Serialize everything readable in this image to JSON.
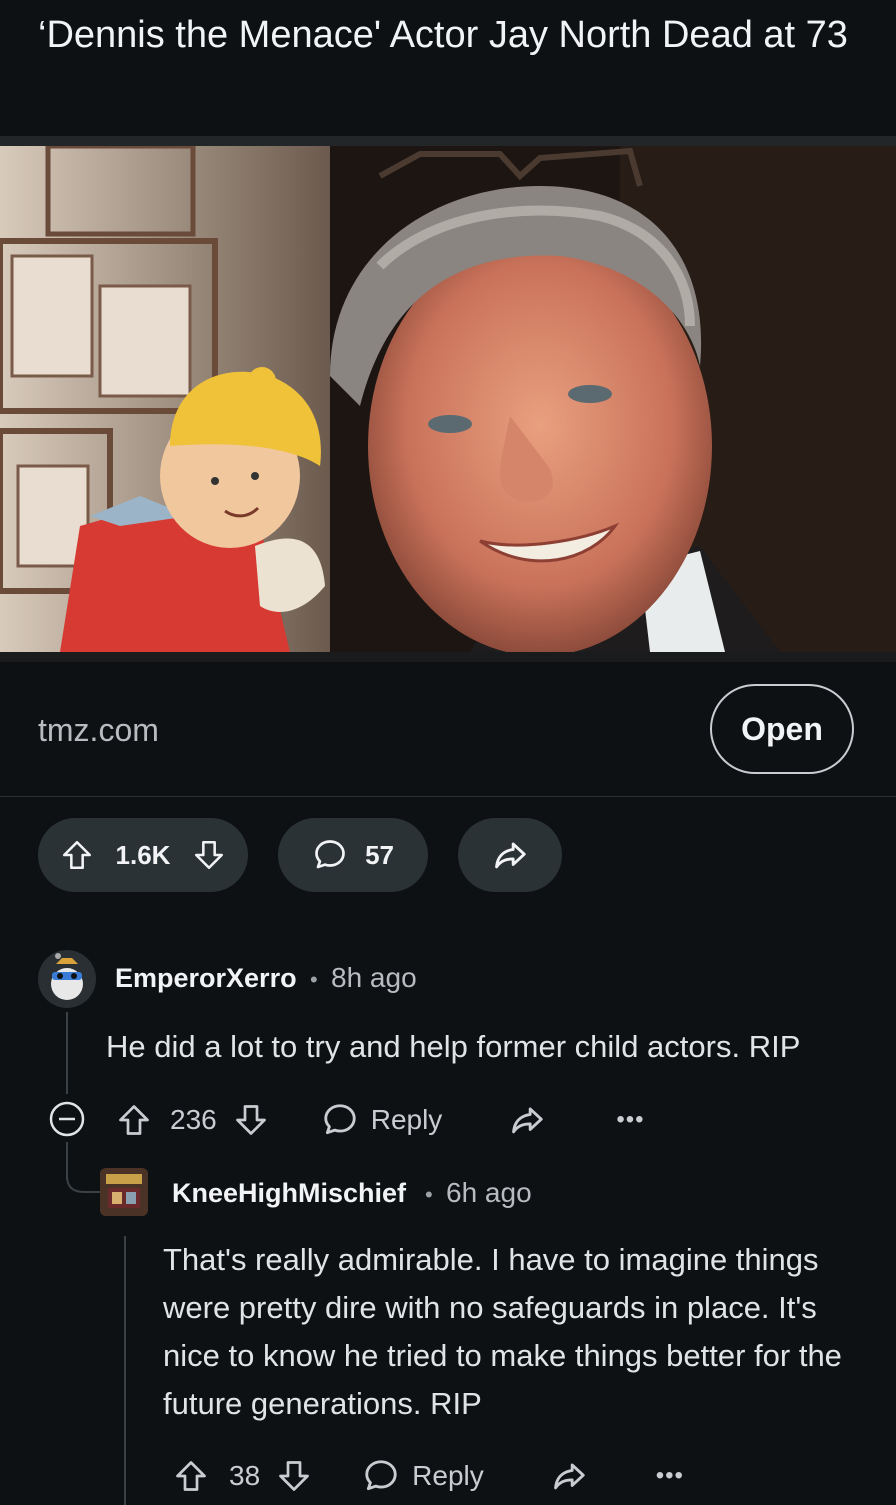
{
  "post": {
    "title": "‘Dennis the Menace' Actor Jay North Dead at 73",
    "domain": "tmz.com",
    "open_label": "Open",
    "upvotes": "1.6K",
    "comments": "57"
  },
  "comments": [
    {
      "user": "EmperorXerro",
      "age": "8h ago",
      "text": "He did a lot to try and help former child actors. RIP",
      "votes": "236",
      "reply_label": "Reply"
    },
    {
      "user": "KneeHighMischief",
      "age": "6h ago",
      "text": "That's really admirable. I have to imagine things were pretty dire with no safeguards in place. It's nice to know he tried to make things better for the future generations. RIP",
      "votes": "38",
      "reply_label": "Reply"
    }
  ],
  "icons": {
    "upvote": "upvote-arrow-icon",
    "downvote": "downvote-arrow-icon",
    "comment": "comment-bubble-icon",
    "share": "share-arrow-icon",
    "more": "more-dots-icon",
    "collapse": "collapse-minus-icon"
  },
  "colors": {
    "background": "#0e1113",
    "pill": "#2a3236"
  }
}
